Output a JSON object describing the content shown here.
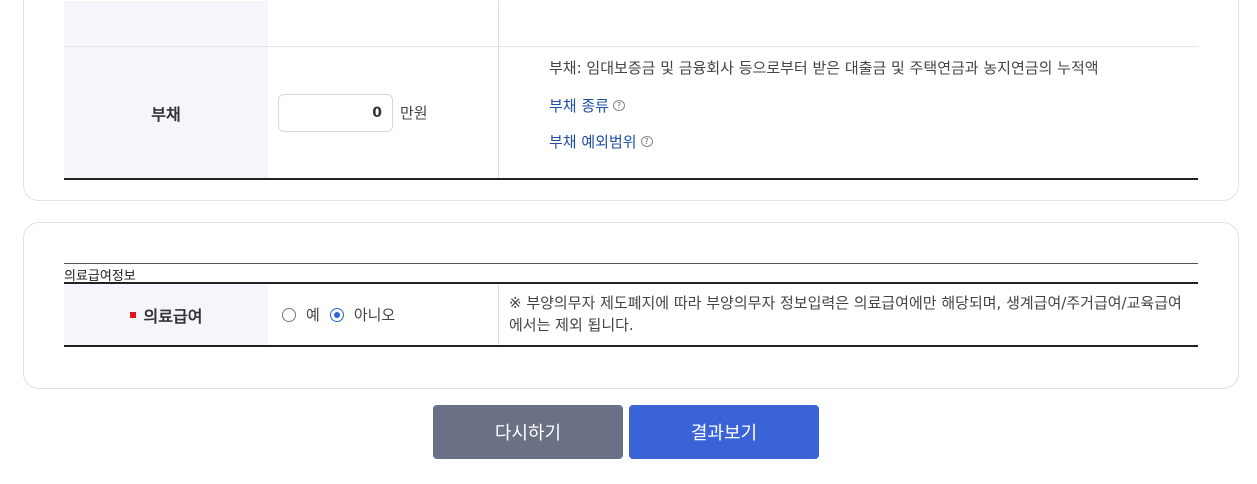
{
  "debt_section": {
    "label": "부채",
    "input_value": "0",
    "unit": "만원",
    "description": "부채: 임대보증금 및 금융회사 등으로부터 받은 대출금 및 주택연금과 농지연금의 누적액",
    "link_types": "부채 종류",
    "link_exceptions": "부채 예외범위",
    "help_icon_glyph": "?"
  },
  "medical_section": {
    "title": "의료급여정보",
    "label": "의료급여",
    "options": [
      {
        "label": "예",
        "checked": false
      },
      {
        "label": "아니오",
        "checked": true
      }
    ],
    "notice": "※ 부양의무자 제도폐지에 따라 부양의무자 정보입력은 의료급여에만 해당되며, 생계급여/주거급여/교육급여에서는 제외 됩니다."
  },
  "buttons": {
    "reset": "다시하기",
    "result": "결과보기"
  },
  "colors": {
    "header_bg": "#f4f6fb",
    "link": "#1f4fa5",
    "required_marker": "#e0141e",
    "reset_button": "#6b7184",
    "result_button": "#3a63d8"
  }
}
